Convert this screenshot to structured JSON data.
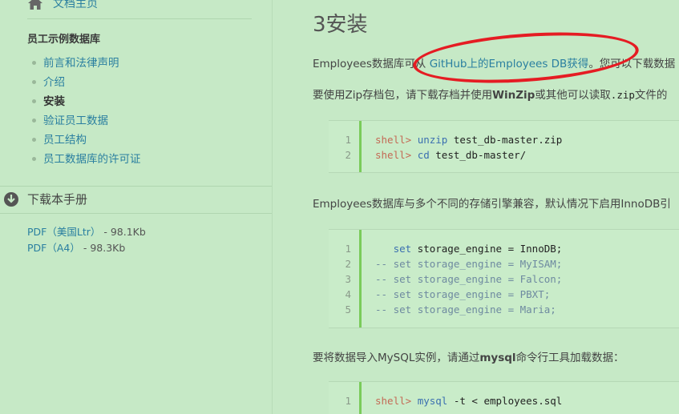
{
  "sidebar": {
    "home_label": "文档主页",
    "section_title": "员工示例数据库",
    "toc": [
      {
        "label": "前言和法律声明",
        "active": false
      },
      {
        "label": "介绍",
        "active": false
      },
      {
        "label": "安装",
        "active": true
      },
      {
        "label": "验证员工数据",
        "active": false
      },
      {
        "label": "员工结构",
        "active": false
      },
      {
        "label": "员工数据库的许可证",
        "active": false
      }
    ],
    "download_title": "下载本手册",
    "downloads": [
      {
        "label": "PDF（美国Ltr）",
        "size": " - 98.1Kb"
      },
      {
        "label": "PDF（A4）",
        "size": " - 98.3Kb"
      }
    ]
  },
  "main": {
    "title": "3安装",
    "p1_prefix": "Employees数据库可从 ",
    "p1_link": "GitHub上的Employees DB获得",
    "p1_suffix": "。您可以下载数据",
    "p2_prefix": "要使用Zip存档包，请下载存档并使用",
    "p2_bold": "WinZip",
    "p2_mid": "或其他可以读取",
    "p2_code": ".zip",
    "p2_suffix": "文件的",
    "code1": [
      {
        "n": "1",
        "prompt": "shell>",
        "cmd": "unzip",
        "rest": " test_db-master.zip"
      },
      {
        "n": "2",
        "prompt": "shell>",
        "cmd": "cd",
        "rest": " test_db-master/"
      }
    ],
    "p3": "Employees数据库与多个不同的存储引擎兼容，默认情况下启用InnoDB引",
    "code2": [
      {
        "n": "1",
        "comment": "",
        "kw": "   set",
        "rest": " storage_engine = InnoDB;"
      },
      {
        "n": "2",
        "comment": "--",
        "kw": " set",
        "rest": " storage_engine = MyISAM;"
      },
      {
        "n": "3",
        "comment": "--",
        "kw": " set",
        "rest": " storage_engine = Falcon;"
      },
      {
        "n": "4",
        "comment": "--",
        "kw": " set",
        "rest": " storage_engine = PBXT;"
      },
      {
        "n": "5",
        "comment": "--",
        "kw": " set",
        "rest": " storage_engine = Maria;"
      }
    ],
    "p4_prefix": "要将数据导入MySQL实例，请通过",
    "p4_bold": "mysql",
    "p4_suffix": "命令行工具加载数据：",
    "code3": [
      {
        "n": "1",
        "prompt": "shell>",
        "cmd": "mysql",
        "rest": " -t < employees.sql"
      }
    ]
  },
  "colors": {
    "accent": "#2a7fa0",
    "highlight_oval": "#e51c23",
    "code_bar": "#7acb5a"
  }
}
